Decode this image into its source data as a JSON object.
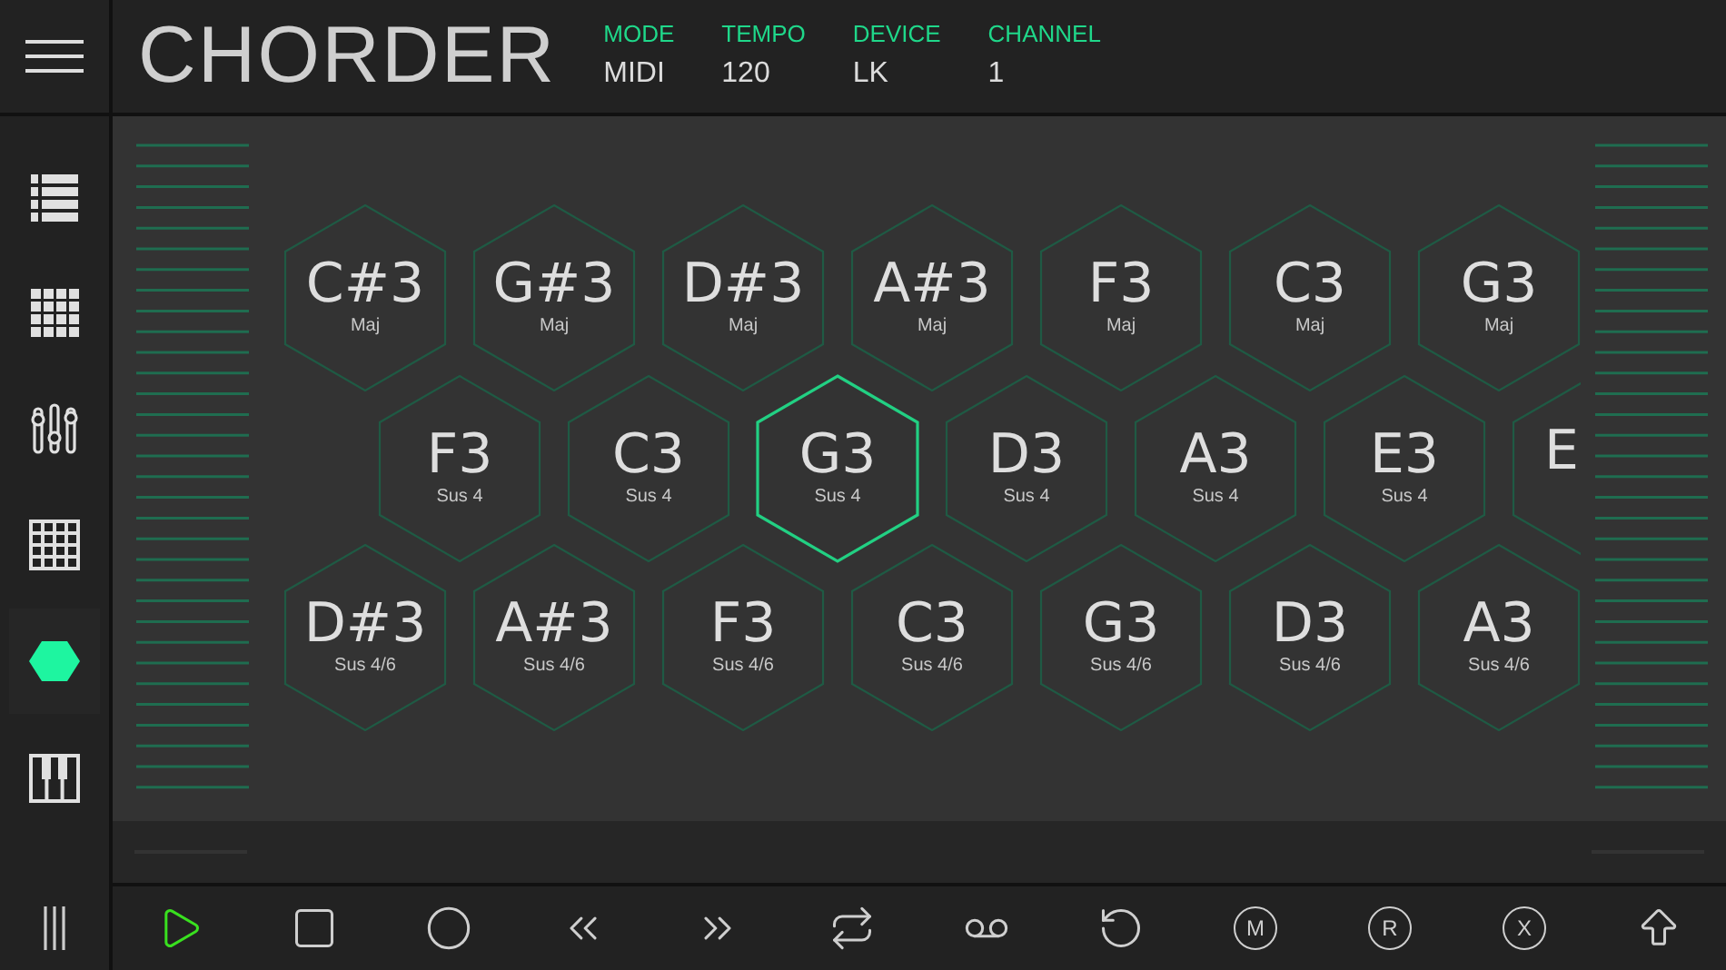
{
  "app": {
    "title": "CHORDER"
  },
  "status": [
    {
      "label": "MODE",
      "value": "MIDI"
    },
    {
      "label": "TEMPO",
      "value": "120"
    },
    {
      "label": "DEVICE",
      "value": "LK"
    },
    {
      "label": "CHANNEL",
      "value": "1"
    }
  ],
  "sidebar": {
    "items": [
      {
        "kind": "list",
        "selected": false
      },
      {
        "kind": "dots",
        "selected": false
      },
      {
        "kind": "mixer",
        "selected": false
      },
      {
        "kind": "grid",
        "selected": false
      },
      {
        "kind": "hexagon",
        "selected": true
      },
      {
        "kind": "piano",
        "selected": false
      }
    ]
  },
  "pads": [
    [
      {
        "note": "C#3",
        "chord": "Maj",
        "selected": false
      },
      {
        "note": "G#3",
        "chord": "Maj",
        "selected": false
      },
      {
        "note": "D#3",
        "chord": "Maj",
        "selected": false
      },
      {
        "note": "A#3",
        "chord": "Maj",
        "selected": false
      },
      {
        "note": "F3",
        "chord": "Maj",
        "selected": false
      },
      {
        "note": "C3",
        "chord": "Maj",
        "selected": false
      },
      {
        "note": "G3",
        "chord": "Maj",
        "selected": false
      }
    ],
    [
      {
        "note": "F3",
        "chord": "Sus 4",
        "selected": false
      },
      {
        "note": "C3",
        "chord": "Sus 4",
        "selected": false
      },
      {
        "note": "G3",
        "chord": "Sus 4",
        "selected": true
      },
      {
        "note": "D3",
        "chord": "Sus 4",
        "selected": false
      },
      {
        "note": "A3",
        "chord": "Sus 4",
        "selected": false
      },
      {
        "note": "E3",
        "chord": "Sus 4",
        "selected": false
      },
      {
        "note": "E",
        "selected": false
      }
    ],
    [
      {
        "note": "D#3",
        "chord": "Sus 4/6",
        "selected": false
      },
      {
        "note": "A#3",
        "chord": "Sus 4/6",
        "selected": false
      },
      {
        "note": "F3",
        "chord": "Sus 4/6",
        "selected": false
      },
      {
        "note": "C3",
        "chord": "Sus 4/6",
        "selected": false
      },
      {
        "note": "G3",
        "chord": "Sus 4/6",
        "selected": false
      },
      {
        "note": "D3",
        "chord": "Sus 4/6",
        "selected": false
      },
      {
        "note": "A3",
        "chord": "Sus 4/6",
        "selected": false
      }
    ]
  ],
  "toolbar": [
    {
      "kind": "play",
      "active": true
    },
    {
      "kind": "stop",
      "active": false
    },
    {
      "kind": "record",
      "active": false
    },
    {
      "kind": "rewind",
      "active": false
    },
    {
      "kind": "forward",
      "active": false
    },
    {
      "kind": "loop",
      "active": false
    },
    {
      "kind": "tape",
      "active": false
    },
    {
      "kind": "undo",
      "active": false
    },
    {
      "kind": "letter",
      "label": "M",
      "active": false
    },
    {
      "kind": "letter",
      "label": "R",
      "active": false
    },
    {
      "kind": "letter",
      "label": "X",
      "active": false
    },
    {
      "kind": "shift",
      "active": false
    }
  ]
}
